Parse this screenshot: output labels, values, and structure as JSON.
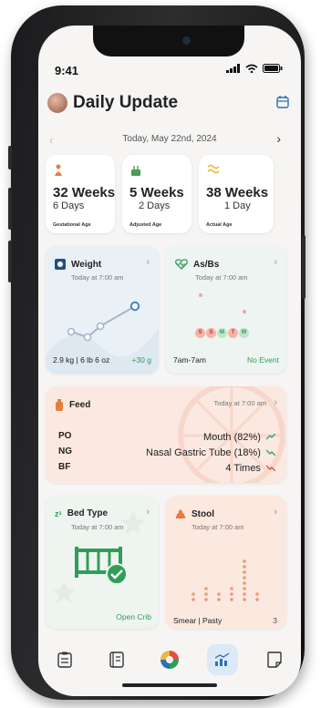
{
  "status": {
    "time": "9:41"
  },
  "header": {
    "title": "Daily Update"
  },
  "date_nav": {
    "date": "Today, May 22nd, 2024"
  },
  "age_cards": [
    {
      "big": "32 Weeks",
      "sub": "6 Days",
      "caption": "Gestational Age"
    },
    {
      "big": "5 Weeks",
      "sub": "2 Days",
      "caption": "Adjusted Age"
    },
    {
      "big": "38 Weeks",
      "sub": "1 Day",
      "caption": "Actual Age"
    }
  ],
  "weight": {
    "label": "Weight",
    "time": "Today at 7:00 am",
    "value": "2.9 kg | 6 lb 6 oz",
    "delta": "+30 g"
  },
  "asbs": {
    "label": "As/Bs",
    "time": "Today at 7:00 am",
    "days": [
      "S",
      "S",
      "M",
      "T",
      "W"
    ],
    "range": "7am-7am",
    "status": "No Event"
  },
  "feed": {
    "label": "Feed",
    "time": "Today at 7:00 am",
    "rows": [
      "PO",
      "NG",
      "BF"
    ],
    "values": [
      "Mouth (82%)",
      "Nasal Gastric Tube (18%)",
      "4 Times"
    ]
  },
  "bed": {
    "label": "Bed Type",
    "time": "Today at 7:00 am",
    "value": "Open Crib"
  },
  "stool": {
    "label": "Stool",
    "time": "Today at 7:00 am",
    "value": "Smear | Pasty",
    "count": "3"
  },
  "colors": {
    "green": "#2f9e58",
    "red": "#d94a3a",
    "blue": "#2e6fb3",
    "orange": "#e77d3d"
  },
  "nav_icons": [
    "clipboard-icon",
    "journal-icon",
    "brand-logo-icon",
    "chart-icon",
    "notes-icon"
  ]
}
